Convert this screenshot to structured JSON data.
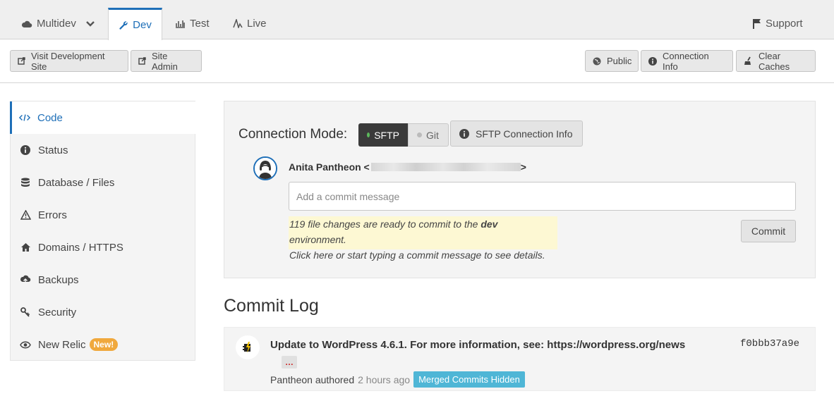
{
  "tabs": {
    "multidev": "Multidev",
    "dev": "Dev",
    "test": "Test",
    "live": "Live",
    "support": "Support"
  },
  "actions": {
    "visit_dev_site": "Visit Development Site",
    "site_admin": "Site Admin",
    "public": "Public",
    "connection_info": "Connection Info",
    "clear_caches": "Clear Caches"
  },
  "sidebar": {
    "items": [
      {
        "label": "Code",
        "icon": "code-icon",
        "active": true
      },
      {
        "label": "Status",
        "icon": "info-icon"
      },
      {
        "label": "Database / Files",
        "icon": "database-icon"
      },
      {
        "label": "Errors",
        "icon": "warning-icon"
      },
      {
        "label": "Domains / HTTPS",
        "icon": "home-icon"
      },
      {
        "label": "Backups",
        "icon": "cloud-upload-icon"
      },
      {
        "label": "Security",
        "icon": "key-icon"
      },
      {
        "label": "New Relic",
        "icon": "eye-icon",
        "badge": "New!"
      }
    ]
  },
  "connection": {
    "label": "Connection Mode:",
    "sftp": "SFTP",
    "git": "Git",
    "info_button": "SFTP Connection Info",
    "author_name": "Anita Pantheon <",
    "author_suffix": ">",
    "commit_placeholder": "Add a commit message",
    "notice_line1_pre": "119 file changes are ready to commit to the ",
    "notice_env": "dev",
    "notice_line1_post": " environment.",
    "notice_line2": "Click here or start typing a commit message to see details.",
    "commit_button": "Commit"
  },
  "commit_log": {
    "title": "Commit Log",
    "entries": [
      {
        "message": "Update to WordPress 4.6.1. For more information, see: https://wordpress.org/news",
        "hash": "f0bbb37a9e",
        "ellipsis": "…",
        "author": "Pantheon authored",
        "time": "2 hours ago",
        "badge": "Merged Commits Hidden"
      }
    ]
  },
  "colors": {
    "accent": "#1e6fb8",
    "sftp_dot": "#5cb85c",
    "git_dot": "#bbbbbb",
    "new_badge": "#f0a83c",
    "merged_badge": "#4fb6d6",
    "notice_bg": "#fdf8d3"
  }
}
